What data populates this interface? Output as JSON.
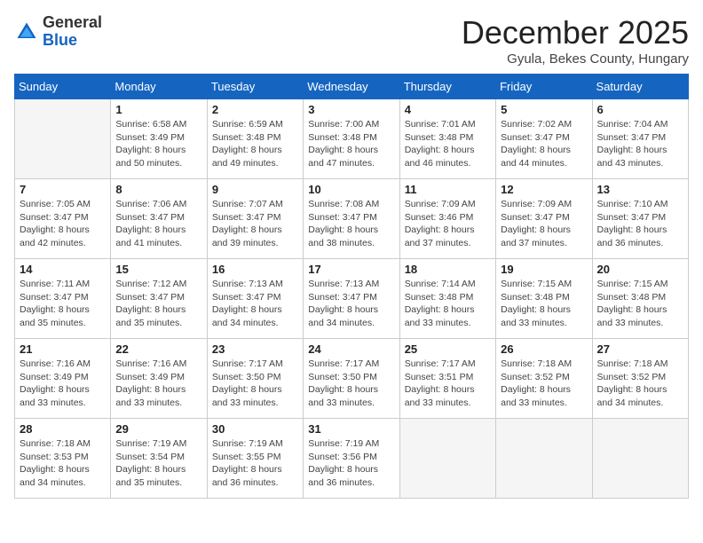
{
  "logo": {
    "general": "General",
    "blue": "Blue"
  },
  "title": "December 2025",
  "subtitle": "Gyula, Bekes County, Hungary",
  "days_of_week": [
    "Sunday",
    "Monday",
    "Tuesday",
    "Wednesday",
    "Thursday",
    "Friday",
    "Saturday"
  ],
  "weeks": [
    [
      {
        "day": "",
        "info": ""
      },
      {
        "day": "1",
        "info": "Sunrise: 6:58 AM\nSunset: 3:49 PM\nDaylight: 8 hours\nand 50 minutes."
      },
      {
        "day": "2",
        "info": "Sunrise: 6:59 AM\nSunset: 3:48 PM\nDaylight: 8 hours\nand 49 minutes."
      },
      {
        "day": "3",
        "info": "Sunrise: 7:00 AM\nSunset: 3:48 PM\nDaylight: 8 hours\nand 47 minutes."
      },
      {
        "day": "4",
        "info": "Sunrise: 7:01 AM\nSunset: 3:48 PM\nDaylight: 8 hours\nand 46 minutes."
      },
      {
        "day": "5",
        "info": "Sunrise: 7:02 AM\nSunset: 3:47 PM\nDaylight: 8 hours\nand 44 minutes."
      },
      {
        "day": "6",
        "info": "Sunrise: 7:04 AM\nSunset: 3:47 PM\nDaylight: 8 hours\nand 43 minutes."
      }
    ],
    [
      {
        "day": "7",
        "info": "Sunrise: 7:05 AM\nSunset: 3:47 PM\nDaylight: 8 hours\nand 42 minutes."
      },
      {
        "day": "8",
        "info": "Sunrise: 7:06 AM\nSunset: 3:47 PM\nDaylight: 8 hours\nand 41 minutes."
      },
      {
        "day": "9",
        "info": "Sunrise: 7:07 AM\nSunset: 3:47 PM\nDaylight: 8 hours\nand 39 minutes."
      },
      {
        "day": "10",
        "info": "Sunrise: 7:08 AM\nSunset: 3:47 PM\nDaylight: 8 hours\nand 38 minutes."
      },
      {
        "day": "11",
        "info": "Sunrise: 7:09 AM\nSunset: 3:46 PM\nDaylight: 8 hours\nand 37 minutes."
      },
      {
        "day": "12",
        "info": "Sunrise: 7:09 AM\nSunset: 3:47 PM\nDaylight: 8 hours\nand 37 minutes."
      },
      {
        "day": "13",
        "info": "Sunrise: 7:10 AM\nSunset: 3:47 PM\nDaylight: 8 hours\nand 36 minutes."
      }
    ],
    [
      {
        "day": "14",
        "info": "Sunrise: 7:11 AM\nSunset: 3:47 PM\nDaylight: 8 hours\nand 35 minutes."
      },
      {
        "day": "15",
        "info": "Sunrise: 7:12 AM\nSunset: 3:47 PM\nDaylight: 8 hours\nand 35 minutes."
      },
      {
        "day": "16",
        "info": "Sunrise: 7:13 AM\nSunset: 3:47 PM\nDaylight: 8 hours\nand 34 minutes."
      },
      {
        "day": "17",
        "info": "Sunrise: 7:13 AM\nSunset: 3:47 PM\nDaylight: 8 hours\nand 34 minutes."
      },
      {
        "day": "18",
        "info": "Sunrise: 7:14 AM\nSunset: 3:48 PM\nDaylight: 8 hours\nand 33 minutes."
      },
      {
        "day": "19",
        "info": "Sunrise: 7:15 AM\nSunset: 3:48 PM\nDaylight: 8 hours\nand 33 minutes."
      },
      {
        "day": "20",
        "info": "Sunrise: 7:15 AM\nSunset: 3:48 PM\nDaylight: 8 hours\nand 33 minutes."
      }
    ],
    [
      {
        "day": "21",
        "info": "Sunrise: 7:16 AM\nSunset: 3:49 PM\nDaylight: 8 hours\nand 33 minutes."
      },
      {
        "day": "22",
        "info": "Sunrise: 7:16 AM\nSunset: 3:49 PM\nDaylight: 8 hours\nand 33 minutes."
      },
      {
        "day": "23",
        "info": "Sunrise: 7:17 AM\nSunset: 3:50 PM\nDaylight: 8 hours\nand 33 minutes."
      },
      {
        "day": "24",
        "info": "Sunrise: 7:17 AM\nSunset: 3:50 PM\nDaylight: 8 hours\nand 33 minutes."
      },
      {
        "day": "25",
        "info": "Sunrise: 7:17 AM\nSunset: 3:51 PM\nDaylight: 8 hours\nand 33 minutes."
      },
      {
        "day": "26",
        "info": "Sunrise: 7:18 AM\nSunset: 3:52 PM\nDaylight: 8 hours\nand 33 minutes."
      },
      {
        "day": "27",
        "info": "Sunrise: 7:18 AM\nSunset: 3:52 PM\nDaylight: 8 hours\nand 34 minutes."
      }
    ],
    [
      {
        "day": "28",
        "info": "Sunrise: 7:18 AM\nSunset: 3:53 PM\nDaylight: 8 hours\nand 34 minutes."
      },
      {
        "day": "29",
        "info": "Sunrise: 7:19 AM\nSunset: 3:54 PM\nDaylight: 8 hours\nand 35 minutes."
      },
      {
        "day": "30",
        "info": "Sunrise: 7:19 AM\nSunset: 3:55 PM\nDaylight: 8 hours\nand 36 minutes."
      },
      {
        "day": "31",
        "info": "Sunrise: 7:19 AM\nSunset: 3:56 PM\nDaylight: 8 hours\nand 36 minutes."
      },
      {
        "day": "",
        "info": ""
      },
      {
        "day": "",
        "info": ""
      },
      {
        "day": "",
        "info": ""
      }
    ]
  ]
}
